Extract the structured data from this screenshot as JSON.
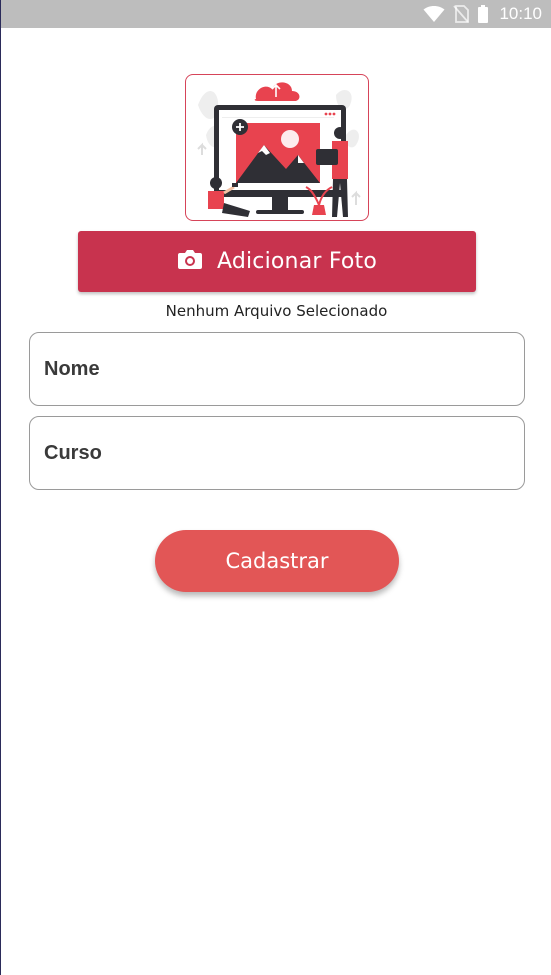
{
  "status_bar": {
    "time": "10:10",
    "icons": [
      "wifi-icon",
      "no-sim-icon",
      "battery-icon"
    ]
  },
  "illustration": {
    "name": "photo-upload-illustration"
  },
  "add_photo": {
    "icon": "camera-icon",
    "label": "Adicionar Foto"
  },
  "file_status": "Nenhum Arquivo Selecionado",
  "fields": {
    "nome": {
      "placeholder": "Nome",
      "value": ""
    },
    "curso": {
      "placeholder": "Curso",
      "value": ""
    }
  },
  "submit": {
    "label": "Cadastrar"
  },
  "colors": {
    "primary": "#c8334e",
    "submit": "#e25656",
    "status_bar": "#bdbdbd"
  }
}
